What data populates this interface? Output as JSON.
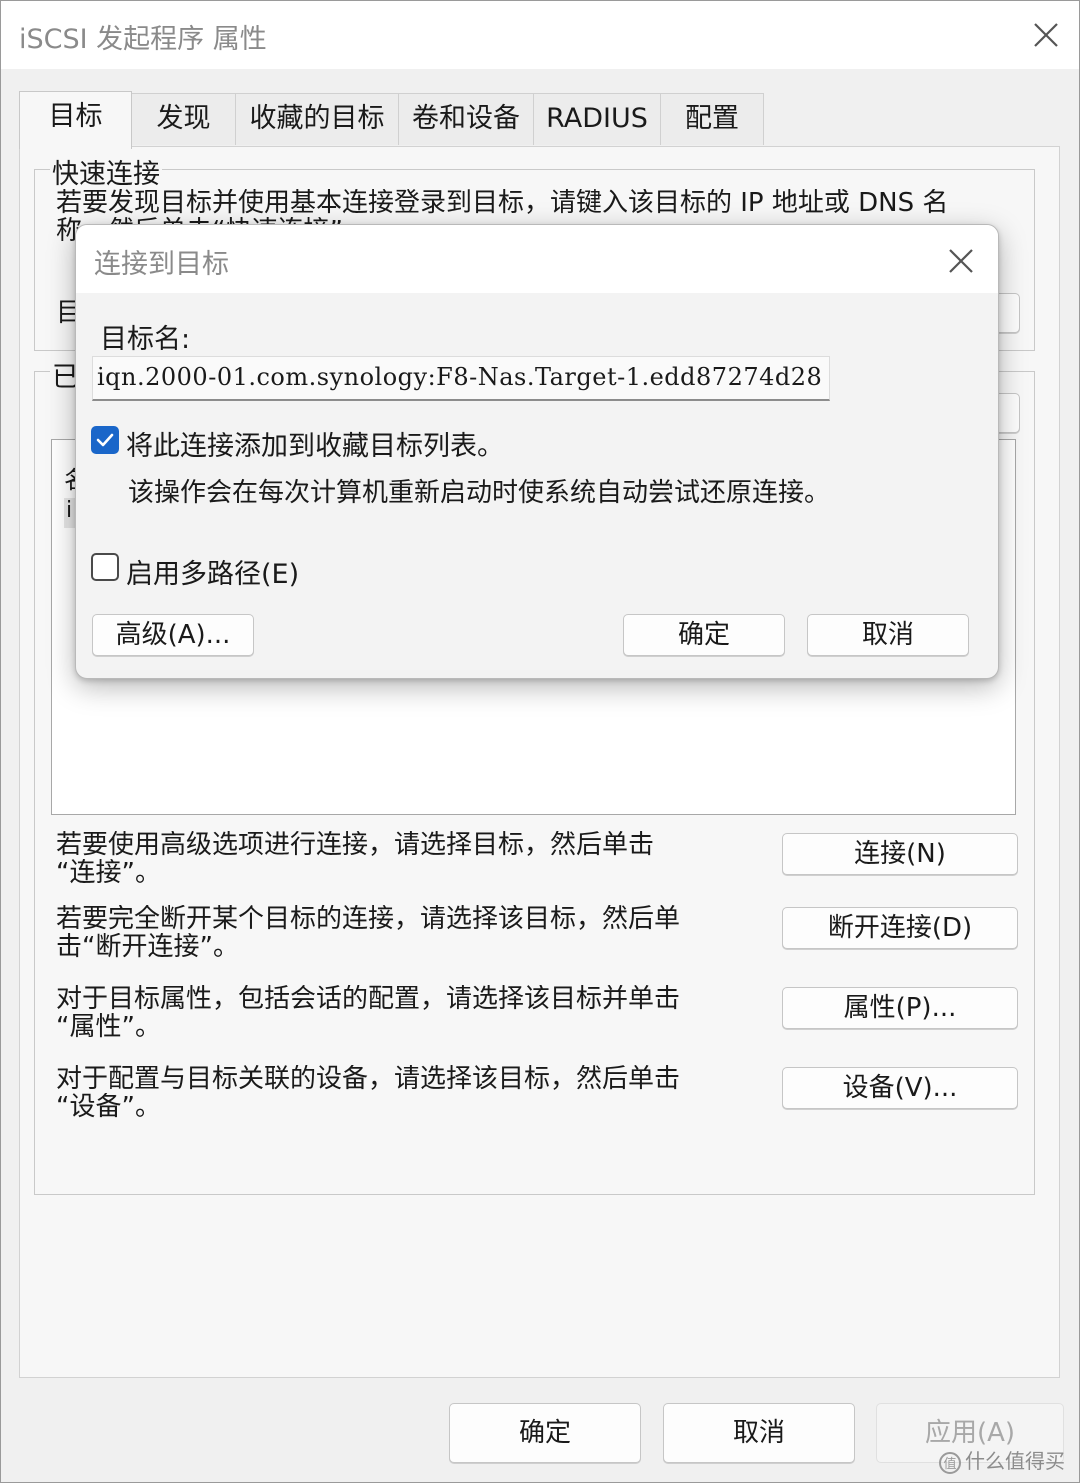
{
  "window": {
    "title": "iSCSI 发起程序 属性"
  },
  "tabs": [
    {
      "label": "目标"
    },
    {
      "label": "发现"
    },
    {
      "label": "收藏的目标"
    },
    {
      "label": "卷和设备"
    },
    {
      "label": "RADIUS"
    },
    {
      "label": "配置"
    }
  ],
  "quick_connect": {
    "group_label": "快速连接",
    "desc_line1": "若要发现目标并使用基本连接登录到目标，请键入该目标的 IP 地址或 DNS 名",
    "desc_line2": "称，然后单击“快速连接”。",
    "target_label_partial": "目"
  },
  "discovered": {
    "group_label_partial": "已"
  },
  "actions": [
    {
      "desc_line1": "若要使用高级选项进行连接，请选择目标，然后单击",
      "desc_line2": "“连接”。",
      "button": "连接(N)"
    },
    {
      "desc_line1": "若要完全断开某个目标的连接，请选择该目标，然后单",
      "desc_line2": "击“断开连接”。",
      "button": "断开连接(D)"
    },
    {
      "desc_line1": "对于目标属性，包括会话的配置，请选择该目标并单击",
      "desc_line2": "“属性”。",
      "button": "属性(P)..."
    },
    {
      "desc_line1": "对于配置与目标关联的设备，请选择该目标，然后单击",
      "desc_line2": "“设备”。",
      "button": "设备(V)..."
    }
  ],
  "footer": {
    "ok": "确定",
    "cancel": "取消",
    "apply": "应用(A)"
  },
  "dialog": {
    "title": "连接到目标",
    "target_name_label": "目标名:",
    "target_name_value": "iqn.2000-01.com.synology:F8-Nas.Target-1.edd87274d28",
    "favorite_checkbox_label": "将此连接添加到收藏目标列表。",
    "favorite_checked": true,
    "favorite_note": "该操作会在每次计算机重新启动时使系统自动尝试还原连接。",
    "multipath_label": "启用多路径(E)",
    "multipath_checked": false,
    "advanced_button": "高级(A)...",
    "ok_button": "确定",
    "cancel_button": "取消"
  },
  "watermark": "什么值得买",
  "colors": {
    "accent": "#1a66c9",
    "window_bg": "#f0f0f0",
    "titlebar_bg": "#ffffff"
  }
}
